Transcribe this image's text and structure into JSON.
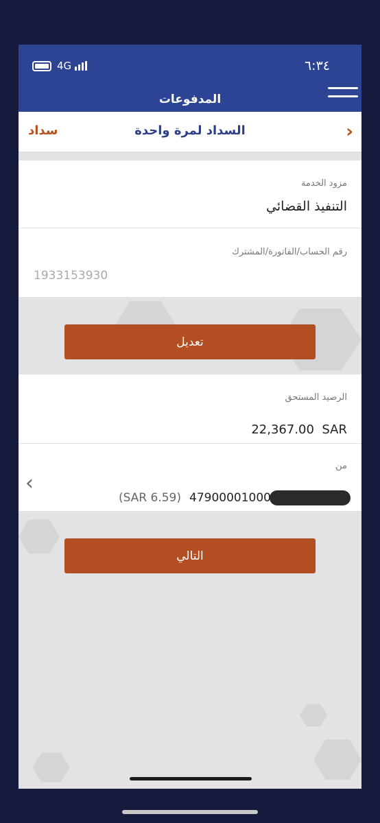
{
  "status": {
    "time": "٦:٣٤",
    "network": "4G"
  },
  "header": {
    "title": "المدفوعات"
  },
  "nav": {
    "back_icon": "chevron-right-icon",
    "title": "السداد لمرة واحدة",
    "brand": "سداد"
  },
  "service": {
    "label": "مزود الخدمة",
    "value": "التنفيذ القضائي"
  },
  "account_ref": {
    "label": "رقم الحساب/الفاتورة/المشترك",
    "placeholder": "1933153930"
  },
  "edit_button": {
    "label": "تعديل"
  },
  "balance": {
    "label": "الرصيد المستحق",
    "amount": "22,367.00",
    "currency": "SAR"
  },
  "from": {
    "label": "من",
    "account_number": "47900001000",
    "account_balance": "(SAR 6.59)",
    "chevron": "chevron-left-icon"
  },
  "next_button": {
    "label": "التالي"
  },
  "colors": {
    "header_blue": "#2d4494",
    "accent_orange": "#b24e21",
    "title_blue": "#2d3f86",
    "brand_orange": "#b5501f"
  }
}
